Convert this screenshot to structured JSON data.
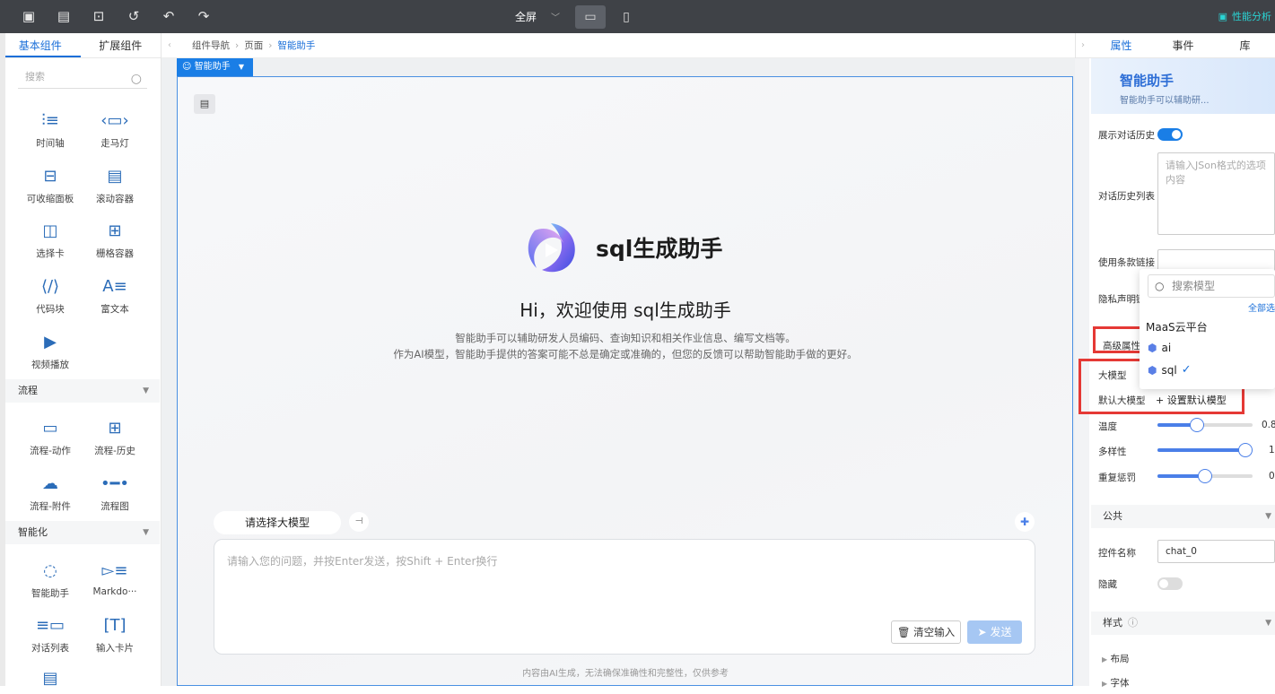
{
  "topbar": {
    "fullscreen_label": "全屏",
    "perf_label": "性能分析"
  },
  "left_panel": {
    "tabs": [
      "基本组件",
      "扩展组件"
    ],
    "search_placeholder": "搜索",
    "components_basic": [
      {
        "label": "时间轴",
        "icon": "timeline-icon"
      },
      {
        "label": "走马灯",
        "icon": "carousel-icon"
      },
      {
        "label": "可收缩面板",
        "icon": "collapse-panel-icon"
      },
      {
        "label": "滚动容器",
        "icon": "scroll-container-icon"
      },
      {
        "label": "选择卡",
        "icon": "tabs-icon"
      },
      {
        "label": "栅格容器",
        "icon": "grid-container-icon"
      },
      {
        "label": "代码块",
        "icon": "code-block-icon"
      },
      {
        "label": "富文本",
        "icon": "rich-text-icon"
      },
      {
        "label": "视频播放",
        "icon": "video-icon"
      }
    ],
    "section_flow": "流程",
    "components_flow": [
      {
        "label": "流程-动作",
        "icon": "flow-action-icon"
      },
      {
        "label": "流程-历史",
        "icon": "flow-history-icon"
      },
      {
        "label": "流程-附件",
        "icon": "flow-attachment-icon"
      },
      {
        "label": "流程图",
        "icon": "flowchart-icon"
      }
    ],
    "section_ai": "智能化",
    "components_ai": [
      {
        "label": "智能助手",
        "icon": "chat-assistant-icon"
      },
      {
        "label": "Markdo···",
        "icon": "markdown-icon"
      },
      {
        "label": "对话列表",
        "icon": "chat-list-icon"
      },
      {
        "label": "输入卡片",
        "icon": "input-card-icon"
      }
    ]
  },
  "breadcrumb": {
    "items": [
      "组件导航",
      "页面",
      "智能助手"
    ]
  },
  "canvas": {
    "selected_tag": "智能助手",
    "app_title": "sql生成助手",
    "greeting": "Hi，欢迎使用 sql生成助手",
    "desc_line1": "智能助手可以辅助研发人员编码、查询知识和相关作业信息、编写文档等。",
    "desc_line2": "作为AI模型，智能助手提供的答案可能不总是确定或准确的，但您的反馈可以帮助智能助手做的更好。",
    "model_select_label": "请选择大模型",
    "input_placeholder": "请输入您的问题，并按Enter发送，按Shift + Enter换行",
    "clear_button": "清空输入",
    "send_button": "发送",
    "disclaimer": "内容由AI生成，无法确保准确性和完整性，仅供参考"
  },
  "right_panel": {
    "tabs": [
      "属性",
      "事件",
      "库"
    ],
    "banner_title": "智能助手",
    "banner_sub": "智能助手可以辅助研...",
    "show_history_label": "展示对话历史",
    "show_history_on": true,
    "history_list_label": "对话历史列表",
    "history_list_placeholder": "请输入JSon格式的选项内容",
    "terms_link_label": "使用条款链接",
    "privacy_label": "隐私声明链",
    "advanced_label": "高级属性",
    "model_label": "大模型",
    "default_model_label": "默认大模型",
    "set_default_label": "+ 设置默认模型",
    "temperature_label": "温度",
    "temperature_value": "0.8",
    "temperature_level": 0.4,
    "diversity_label": "多样性",
    "diversity_value": "1",
    "diversity_level": 1.0,
    "penalty_label": "重复惩罚",
    "penalty_value": "0",
    "penalty_level": 0.5,
    "section_public": "公共",
    "control_name_label": "控件名称",
    "control_name_value": "chat_0",
    "hidden_label": "隐藏",
    "hidden_on": false,
    "section_style": "样式",
    "layout_label": "布局",
    "font_label": "字体"
  },
  "model_dropdown": {
    "search_placeholder": "搜索模型",
    "select_all": "全部选",
    "group": "MaaS云平台",
    "items": [
      {
        "label": "ai",
        "checked": false
      },
      {
        "label": "sql",
        "checked": true
      }
    ]
  },
  "colors": {
    "accent": "#1a7ee6",
    "highlight_box": "#e53935",
    "perf": "#2ad4d4"
  }
}
